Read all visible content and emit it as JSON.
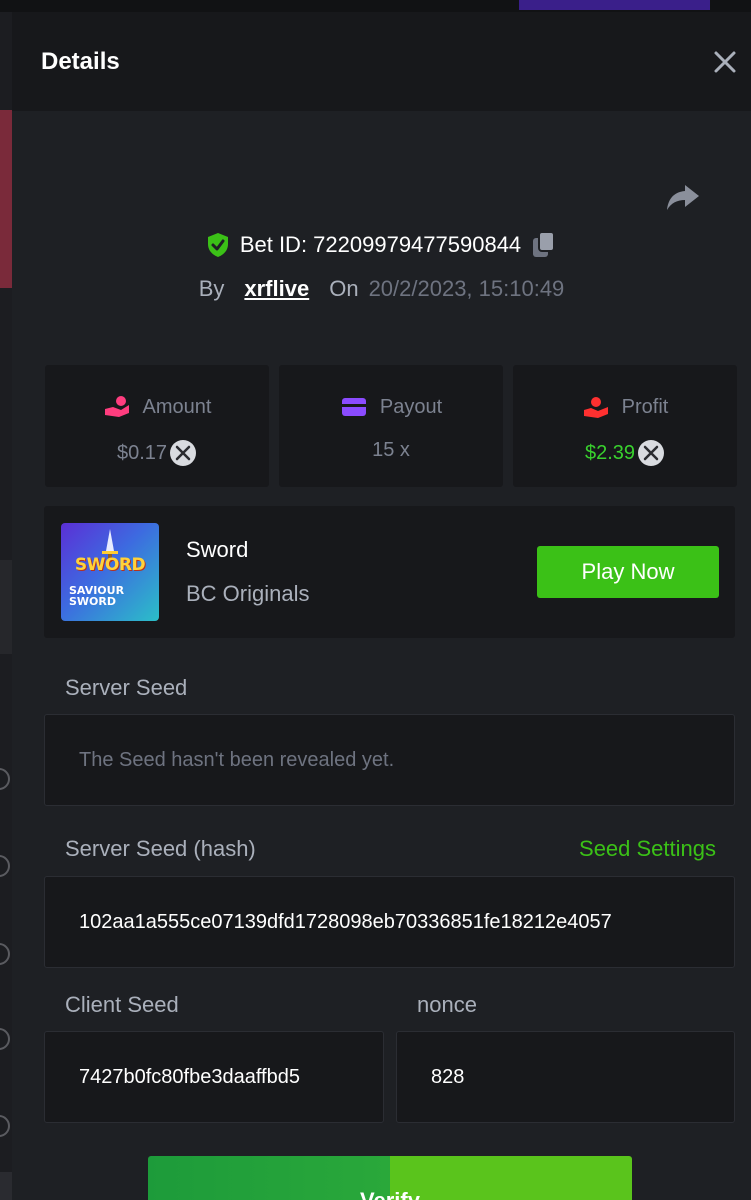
{
  "modal": {
    "title": "Details"
  },
  "bet": {
    "id_label": "Bet ID: 72209979477590844",
    "by_label": "By",
    "user": "xrflive",
    "on_label": "On",
    "date": "20/2/2023, 15:10:49"
  },
  "stats": {
    "amount_label": "Amount",
    "amount_value": "$0.17",
    "payout_label": "Payout",
    "payout_value": "15 x",
    "profit_label": "Profit",
    "profit_value": "$2.39"
  },
  "game": {
    "thumb_title": "SWORD",
    "thumb_sub1": "SAVIOUR",
    "thumb_sub2": "SWORD",
    "name": "Sword",
    "provider": "BC Originals",
    "play_label": "Play Now"
  },
  "seeds": {
    "server_seed_label": "Server Seed",
    "server_seed_value": "The Seed hasn't been revealed yet.",
    "server_hash_label": "Server Seed (hash)",
    "seed_settings_label": "Seed Settings",
    "server_hash_value": "102aa1a555ce07139dfd1728098eb70336851fe18212e4057",
    "client_seed_label": "Client Seed",
    "client_seed_value": "7427b0fc80fbe3daaffbd5",
    "nonce_label": "nonce",
    "nonce_value": "828"
  },
  "actions": {
    "verify_label": "Verify"
  },
  "colors": {
    "accent_green": "#3bc117",
    "profit_green": "#39d12e",
    "panel_bg": "#1e2024",
    "card_bg": "#17181b"
  }
}
